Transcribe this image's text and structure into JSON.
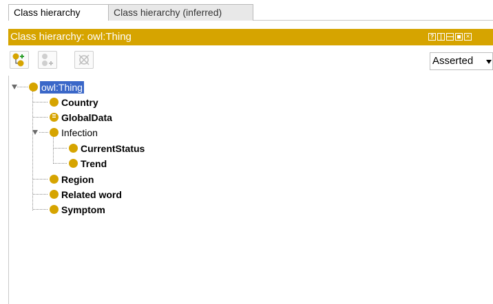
{
  "tabs": [
    {
      "label": "Class hierarchy",
      "active": true
    },
    {
      "label": "Class hierarchy (inferred)",
      "active": false
    }
  ],
  "view": {
    "title": "Class hierarchy: owl:Thing",
    "header_color": "#d6a400",
    "header_buttons": [
      "help-icon",
      "split-vertical-icon",
      "split-horizontal-icon",
      "maximize-icon",
      "close-icon"
    ]
  },
  "toolbar": {
    "buttons": [
      "add-subclass-icon",
      "add-sibling-class-icon",
      "delete-class-icon"
    ],
    "mode_select": {
      "value": "Asserted"
    }
  },
  "tree": {
    "root": {
      "label": "owl:Thing",
      "selected": true,
      "expanded": true
    },
    "items": [
      {
        "label": "Country",
        "bold": true
      },
      {
        "label": "GlobalData",
        "bold": true,
        "icon": "defined-class-icon"
      },
      {
        "label": "Infection",
        "bold": false,
        "expanded": true,
        "children": [
          {
            "label": "CurrentStatus",
            "bold": true
          },
          {
            "label": "Trend",
            "bold": true
          }
        ]
      },
      {
        "label": "Region",
        "bold": true
      },
      {
        "label": "Related word",
        "bold": true
      },
      {
        "label": "Symptom",
        "bold": true
      }
    ]
  },
  "colors": {
    "class_icon": "#d6a400",
    "selection": "#3a67c8"
  }
}
